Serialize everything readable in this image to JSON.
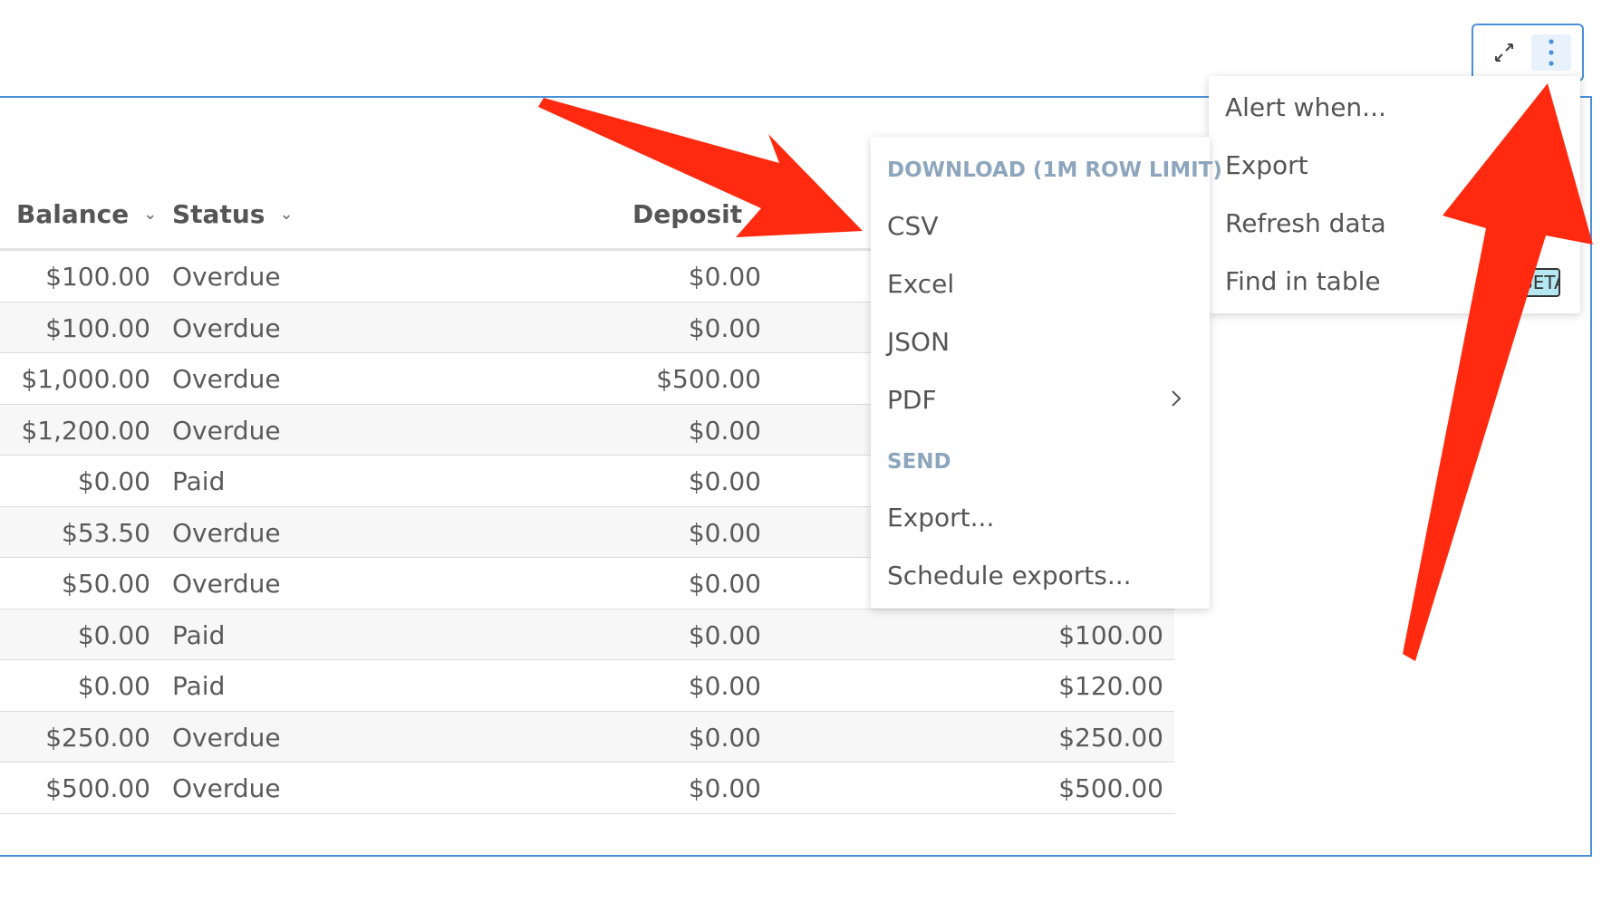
{
  "table": {
    "headers": {
      "balance": "Balance",
      "status": "Status",
      "deposit": "Deposit"
    },
    "rows": [
      {
        "balance": "$100.00",
        "status": "Overdue",
        "deposit": "$0.00",
        "last": ""
      },
      {
        "balance": "$100.00",
        "status": "Overdue",
        "deposit": "$0.00",
        "last": ""
      },
      {
        "balance": "$1,000.00",
        "status": "Overdue",
        "deposit": "$500.00",
        "last": ""
      },
      {
        "balance": "$1,200.00",
        "status": "Overdue",
        "deposit": "$0.00",
        "last": ""
      },
      {
        "balance": "$0.00",
        "status": "Paid",
        "deposit": "$0.00",
        "last": ""
      },
      {
        "balance": "$53.50",
        "status": "Overdue",
        "deposit": "$0.00",
        "last": ""
      },
      {
        "balance": "$50.00",
        "status": "Overdue",
        "deposit": "$0.00",
        "last": ""
      },
      {
        "balance": "$0.00",
        "status": "Paid",
        "deposit": "$0.00",
        "last": "$100.00"
      },
      {
        "balance": "$0.00",
        "status": "Paid",
        "deposit": "$0.00",
        "last": "$120.00"
      },
      {
        "balance": "$250.00",
        "status": "Overdue",
        "deposit": "$0.00",
        "last": "$250.00"
      },
      {
        "balance": "$500.00",
        "status": "Overdue",
        "deposit": "$0.00",
        "last": "$500.00"
      }
    ]
  },
  "main_menu": {
    "items": [
      "Alert when...",
      "Export",
      "Refresh data",
      "Find in table"
    ],
    "badge": "BETA"
  },
  "export_menu": {
    "download_header": "DOWNLOAD (1M ROW LIMIT)",
    "download_items": [
      "CSV",
      "Excel",
      "JSON",
      "PDF"
    ],
    "send_header": "SEND",
    "send_items": [
      "Export...",
      "Schedule exports..."
    ]
  },
  "icons": {
    "expand": "expand-icon",
    "more": "more-vertical-icon",
    "sort": "chevron-down-icon",
    "submenu": "chevron-right-icon"
  },
  "colors": {
    "accent_border": "#4a90d9",
    "section_header": "#8ea6bd",
    "annotation_arrow": "#ff2a0f",
    "badge_bg": "#b6e8f3"
  }
}
